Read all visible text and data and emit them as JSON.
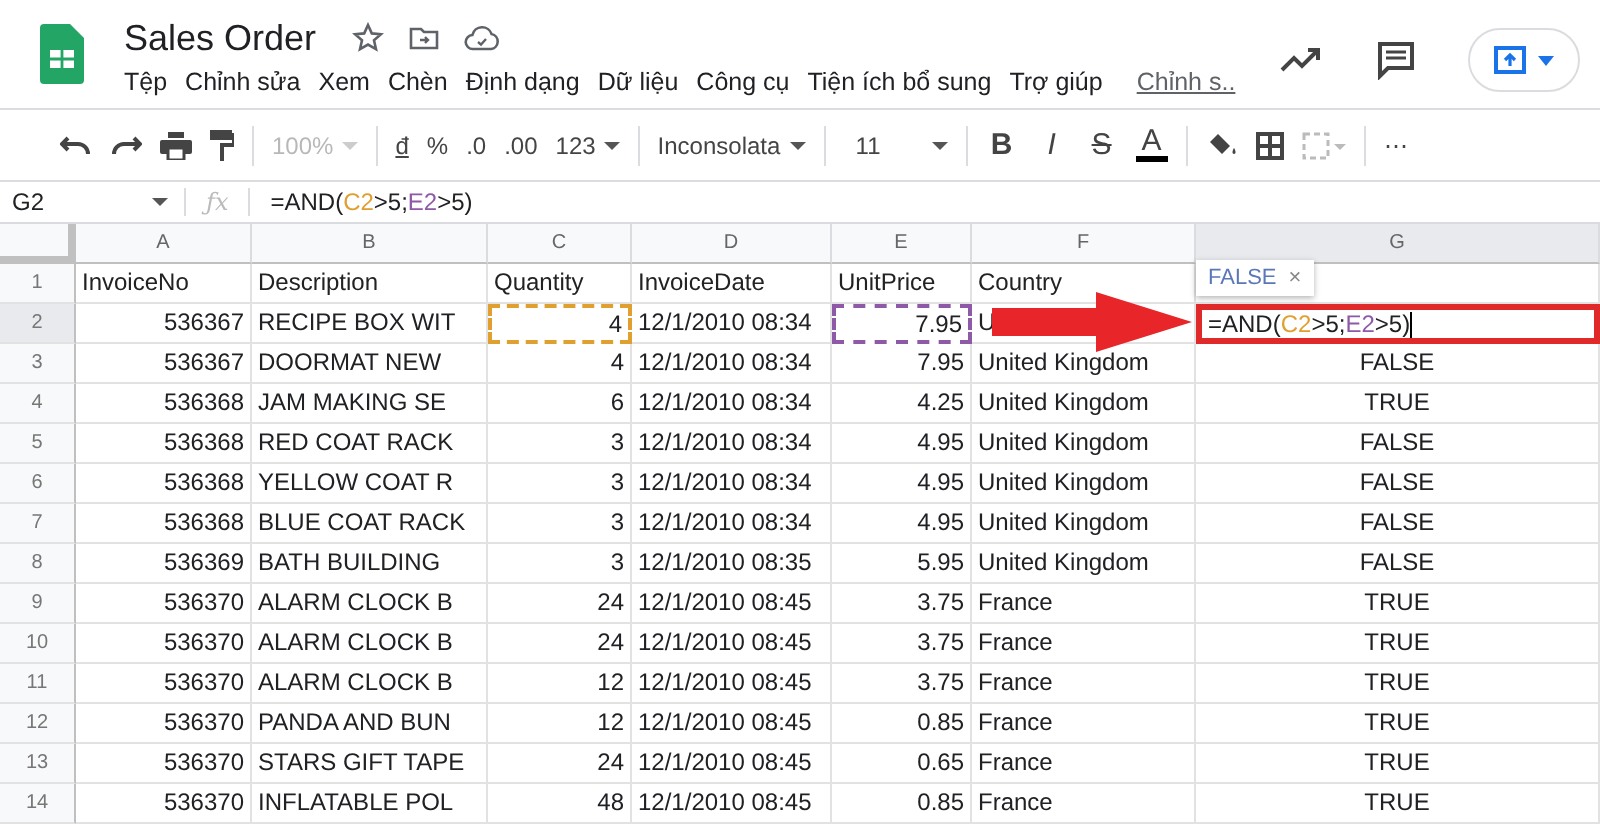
{
  "document": {
    "title": "Sales Order"
  },
  "menu": [
    "Tệp",
    "Chỉnh sửa",
    "Xem",
    "Chèn",
    "Định dạng",
    "Dữ liệu",
    "Công cụ",
    "Tiện ích bổ sung",
    "Trợ giúp"
  ],
  "last_edit": "Chỉnh s..",
  "toolbar": {
    "zoom": "100%",
    "currency": "đ",
    "percent": "%",
    "dec_less": ".0",
    "dec_more": ".00",
    "format": "123",
    "font": "Inconsolata",
    "size": "11",
    "bold": "B",
    "italic": "I",
    "strike": "S",
    "text_color": "A",
    "more": "⋯"
  },
  "name_box": "G2",
  "fx": "ƒx",
  "formula_bar": [
    {
      "kind": "plain",
      "text": "=AND("
    },
    {
      "kind": "ref",
      "text": "C2",
      "color": "#e0a030"
    },
    {
      "kind": "plain",
      "text": ">5;"
    },
    {
      "kind": "ref",
      "text": "E2",
      "color": "#8e5aa8"
    },
    {
      "kind": "plain",
      "text": ">5)"
    }
  ],
  "columns": [
    {
      "letter": "A",
      "kind": "number"
    },
    {
      "letter": "B",
      "kind": "text"
    },
    {
      "letter": "C",
      "kind": "number"
    },
    {
      "letter": "D",
      "kind": "text"
    },
    {
      "letter": "E",
      "kind": "number"
    },
    {
      "letter": "F",
      "kind": "text"
    },
    {
      "letter": "G",
      "kind": "bool"
    }
  ],
  "rows": [
    {
      "num": "1",
      "header": true,
      "cells": [
        "InvoiceNo",
        "Description",
        "Quantity",
        "InvoiceDate",
        "UnitPrice",
        "Country"
      ]
    },
    {
      "num": "2",
      "header": false,
      "cells": [
        "536367",
        "RECIPE BOX WIT",
        {
          "text": "4",
          "color": "#e0a030"
        },
        "12/1/2010 08:34",
        {
          "text": "7.95",
          "color": "#8e5aa8"
        },
        "U",
        {
          "kind": "editor"
        }
      ]
    },
    {
      "num": "3",
      "header": false,
      "cells": [
        "536367",
        "DOORMAT NEW",
        "4",
        "12/1/2010 08:34",
        "7.95",
        "United Kingdom",
        "FALSE"
      ]
    },
    {
      "num": "4",
      "header": false,
      "cells": [
        "536368",
        "JAM MAKING SE",
        "6",
        "12/1/2010 08:34",
        "4.25",
        "United Kingdom",
        "TRUE"
      ]
    },
    {
      "num": "5",
      "header": false,
      "cells": [
        "536368",
        "RED COAT RACK",
        "3",
        "12/1/2010 08:34",
        "4.95",
        "United Kingdom",
        "FALSE"
      ]
    },
    {
      "num": "6",
      "header": false,
      "cells": [
        "536368",
        "YELLOW COAT R",
        "3",
        "12/1/2010 08:34",
        "4.95",
        "United Kingdom",
        "FALSE"
      ]
    },
    {
      "num": "7",
      "header": false,
      "cells": [
        "536368",
        "BLUE COAT RACK",
        "3",
        "12/1/2010 08:34",
        "4.95",
        "United Kingdom",
        "FALSE"
      ]
    },
    {
      "num": "8",
      "header": false,
      "cells": [
        "536369",
        "BATH BUILDING",
        "3",
        "12/1/2010 08:35",
        "5.95",
        "United Kingdom",
        "FALSE"
      ]
    },
    {
      "num": "9",
      "header": false,
      "cells": [
        "536370",
        "ALARM CLOCK B",
        "24",
        "12/1/2010 08:45",
        "3.75",
        "France",
        "TRUE"
      ]
    },
    {
      "num": "10",
      "header": false,
      "cells": [
        "536370",
        "ALARM CLOCK B",
        "24",
        "12/1/2010 08:45",
        "3.75",
        "France",
        "TRUE"
      ]
    },
    {
      "num": "11",
      "header": false,
      "cells": [
        "536370",
        "ALARM CLOCK B",
        "12",
        "12/1/2010 08:45",
        "3.75",
        "France",
        "TRUE"
      ]
    },
    {
      "num": "12",
      "header": false,
      "cells": [
        "536370",
        "PANDA AND BUN",
        "12",
        "12/1/2010 08:45",
        "0.85",
        "France",
        "TRUE"
      ]
    },
    {
      "num": "13",
      "header": false,
      "cells": [
        "536370",
        "STARS GIFT TAPE",
        "24",
        "12/1/2010 08:45",
        "0.65",
        "France",
        "TRUE"
      ]
    },
    {
      "num": "14",
      "header": false,
      "cells": [
        "536370",
        "INFLATABLE POL",
        "48",
        "12/1/2010 08:45",
        "0.85",
        "France",
        "TRUE"
      ]
    }
  ],
  "editor": [
    {
      "kind": "plain",
      "text": "=AND("
    },
    {
      "kind": "ref",
      "text": "C2",
      "color": "#e0a030"
    },
    {
      "kind": "plain",
      "text": ">5;"
    },
    {
      "kind": "ref",
      "text": "E2",
      "color": "#8e5aa8"
    },
    {
      "kind": "plain",
      "text": ">5)"
    }
  ],
  "result_tip": {
    "value": "FALSE",
    "close": "×"
  }
}
